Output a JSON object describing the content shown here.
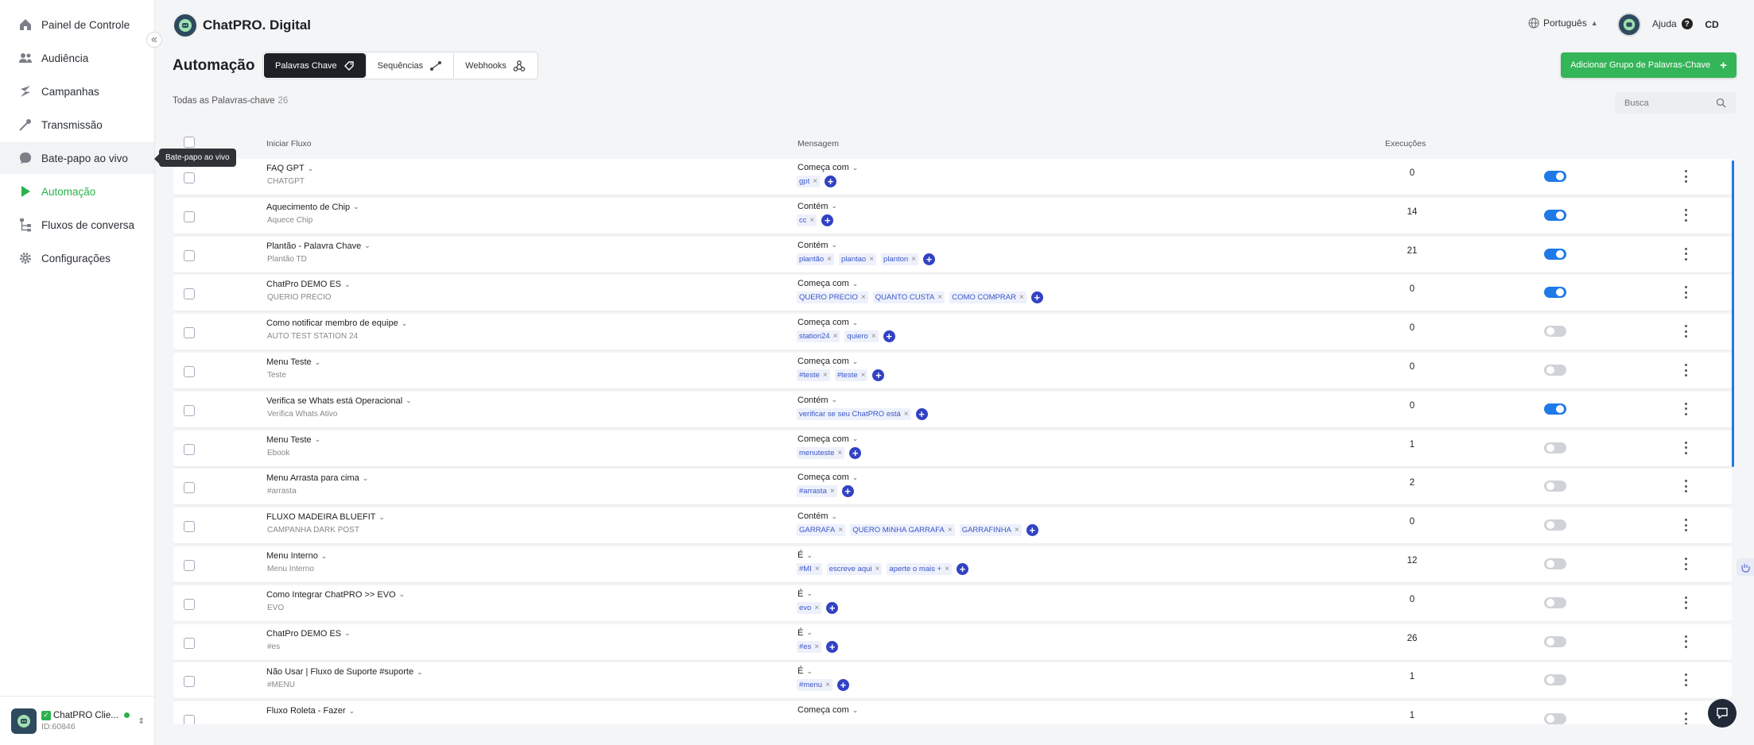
{
  "sidebar": {
    "items": [
      {
        "key": "painel",
        "label": "Painel de Controle",
        "icon": "home-icon"
      },
      {
        "key": "audiencia",
        "label": "Audiência",
        "icon": "users-icon"
      },
      {
        "key": "campanhas",
        "label": "Campanhas",
        "icon": "bolt-icon"
      },
      {
        "key": "transmissao",
        "label": "Transmissão",
        "icon": "broadcast-icon"
      },
      {
        "key": "batepapo",
        "label": "Bate-papo ao vivo",
        "icon": "chat-bubble-icon"
      },
      {
        "key": "automacao",
        "label": "Automação",
        "icon": "play-icon"
      },
      {
        "key": "fluxos",
        "label": "Fluxos de conversa",
        "icon": "flow-icon"
      },
      {
        "key": "config",
        "label": "Configurações",
        "icon": "gear-icon"
      }
    ],
    "tooltip": "Bate-papo ao vivo",
    "account": {
      "name": "ChatPRO Clie...",
      "id": "ID:60846"
    }
  },
  "header": {
    "brand": "ChatPRO. Digital",
    "language": "Português",
    "help": "Ajuda",
    "initials": "CD"
  },
  "page": {
    "title": "Automação",
    "tabs": [
      {
        "label": "Palavras Chave",
        "icon": "tag-icon",
        "active": true
      },
      {
        "label": "Sequências",
        "icon": "sequence-icon",
        "active": false
      },
      {
        "label": "Webhooks",
        "icon": "webhook-icon",
        "active": false
      }
    ],
    "add_button": "Adicionar Grupo de Palavras-Chave",
    "count_label": "Todas as Palavras-chave",
    "count": "26",
    "search_placeholder": "Busca"
  },
  "table": {
    "columns": {
      "flow": "Iniciar Fluxo",
      "message": "Mensagem",
      "executions": "Execuções"
    },
    "rows": [
      {
        "name": "FAQ GPT",
        "sub": "CHATGPT",
        "match": "Começa com",
        "keywords": [
          "gpt"
        ],
        "executions": "0",
        "enabled": true
      },
      {
        "name": "Aquecimento de Chip",
        "sub": "Aquece Chip",
        "match": "Contém",
        "keywords": [
          "cc"
        ],
        "executions": "14",
        "enabled": true
      },
      {
        "name": "Plantão - Palavra Chave",
        "sub": "Plantão TD",
        "match": "Contém",
        "keywords": [
          "plantão",
          "plantao",
          "planton"
        ],
        "executions": "21",
        "enabled": true
      },
      {
        "name": "ChatPro DEMO ES",
        "sub": "QUERIO PRECIO",
        "match": "Começa com",
        "keywords": [
          "QUERO PRECIO",
          "QUANTO CUSTA",
          "COMO COMPRAR"
        ],
        "executions": "0",
        "enabled": true
      },
      {
        "name": "Como notificar membro de equipe",
        "sub": "AUTO TEST STATION 24",
        "match": "Começa com",
        "keywords": [
          "station24",
          "quiero"
        ],
        "executions": "0",
        "enabled": false
      },
      {
        "name": "Menu Teste",
        "sub": "Teste",
        "match": "Começa com",
        "keywords": [
          "#teste",
          "#teste"
        ],
        "executions": "0",
        "enabled": false
      },
      {
        "name": "Verifica se Whats está Operacional",
        "sub": "Verifica Whats Ativo",
        "match": "Contém",
        "keywords": [
          "verificar se seu ChatPRO está"
        ],
        "executions": "0",
        "enabled": true
      },
      {
        "name": "Menu Teste",
        "sub": "Ebook",
        "match": "Começa com",
        "keywords": [
          "menuteste"
        ],
        "executions": "1",
        "enabled": false
      },
      {
        "name": "Menu Arrasta para cima",
        "sub": "#arrasta",
        "match": "Começa com",
        "keywords": [
          "#arrasta"
        ],
        "executions": "2",
        "enabled": false
      },
      {
        "name": "FLUXO MADEIRA BLUEFIT",
        "sub": "CAMPANHA DARK POST",
        "match": "Contém",
        "keywords": [
          "GARRAFA",
          "QUERO MINHA GARRAFA",
          "GARRAFINHA"
        ],
        "executions": "0",
        "enabled": false
      },
      {
        "name": "Menu Interno",
        "sub": "Menu Interno",
        "match": "É",
        "keywords": [
          "#MI",
          "escreve aqui",
          "aperte o mais +"
        ],
        "executions": "12",
        "enabled": false
      },
      {
        "name": "Como Integrar ChatPRO >> EVO",
        "sub": "EVO",
        "match": "É",
        "keywords": [
          "evo"
        ],
        "executions": "0",
        "enabled": false
      },
      {
        "name": "ChatPro DEMO ES",
        "sub": "#es",
        "match": "É",
        "keywords": [
          "#es"
        ],
        "executions": "26",
        "enabled": false
      },
      {
        "name": "Não Usar | Fluxo de Suporte #suporte",
        "sub": "#MENU",
        "match": "É",
        "keywords": [
          "#menu"
        ],
        "executions": "1",
        "enabled": false
      },
      {
        "name": "Fluxo Roleta - Fazer",
        "sub": "",
        "match": "Começa com",
        "keywords": [],
        "executions": "1",
        "enabled": false
      }
    ]
  },
  "colors": {
    "accent_green": "#35b559",
    "toggle_on": "#1e7ae6",
    "chip_add": "#3242c4"
  }
}
